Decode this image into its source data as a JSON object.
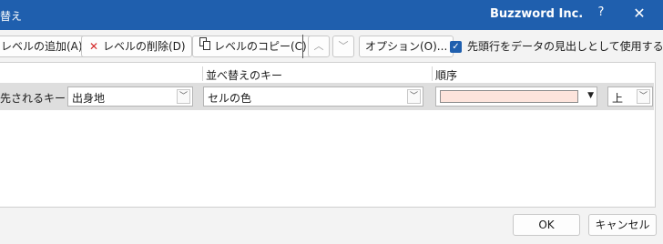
{
  "window": {
    "title": "替え",
    "account": "Buzzword Inc.",
    "help_icon": "?",
    "close_icon": "✕"
  },
  "toolbar": {
    "add_level": "レベルの追加(A)",
    "delete_level": "レベルの削除(D)",
    "copy_level": "レベルのコピー(C)",
    "move_up_icon": "^",
    "move_down_icon": "v",
    "options": "オプション(O)...",
    "header_checkbox_label": "先頭行をデータの見出しとして使用する(H)",
    "header_checkbox_checked": true
  },
  "columns": {
    "sort_key": "並べ替えのキー",
    "order": "順序"
  },
  "level_row": {
    "label": "先されるキー",
    "column_value": "出身地",
    "sort_on_value": "セルの色",
    "color": "#fde4dc",
    "order_value": "上"
  },
  "buttons": {
    "ok": "OK",
    "cancel": "キャンセル"
  }
}
